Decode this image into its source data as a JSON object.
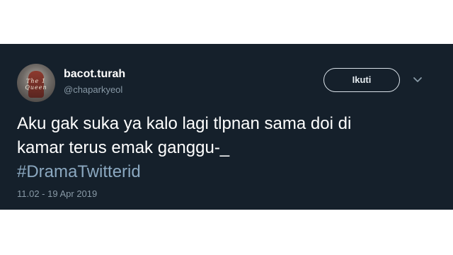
{
  "tweet": {
    "user": {
      "display_name": "bacot.turah",
      "handle": "@chaparkyeol",
      "avatar_text": "The 1 Queen"
    },
    "follow_label": "Ikuti",
    "text_line1": "Aku gak suka ya kalo lagi tlpnan sama doi di",
    "text_line2": "kamar terus emak ganggu-_",
    "hashtag": "#DramaTwitterid",
    "timestamp": "11.02 - 19 Apr 2019"
  },
  "colors": {
    "card_background": "#15202b",
    "text": "#ffffff",
    "secondary_text": "#8899a6",
    "hashtag": "#8ba8c0"
  },
  "icons": {
    "menu": "chevron-down-icon"
  }
}
